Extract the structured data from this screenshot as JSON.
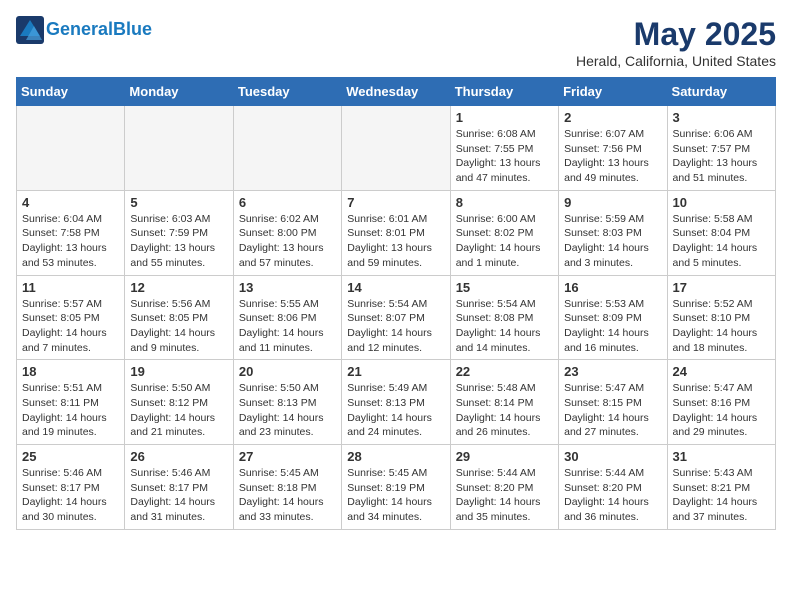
{
  "header": {
    "logo_line1": "General",
    "logo_line2": "Blue",
    "month_title": "May 2025",
    "location": "Herald, California, United States"
  },
  "days_of_week": [
    "Sunday",
    "Monday",
    "Tuesday",
    "Wednesday",
    "Thursday",
    "Friday",
    "Saturday"
  ],
  "weeks": [
    [
      {
        "day": "",
        "empty": true
      },
      {
        "day": "",
        "empty": true
      },
      {
        "day": "",
        "empty": true
      },
      {
        "day": "",
        "empty": true
      },
      {
        "day": "1",
        "sunrise": "Sunrise: 6:08 AM",
        "sunset": "Sunset: 7:55 PM",
        "daylight": "Daylight: 13 hours and 47 minutes."
      },
      {
        "day": "2",
        "sunrise": "Sunrise: 6:07 AM",
        "sunset": "Sunset: 7:56 PM",
        "daylight": "Daylight: 13 hours and 49 minutes."
      },
      {
        "day": "3",
        "sunrise": "Sunrise: 6:06 AM",
        "sunset": "Sunset: 7:57 PM",
        "daylight": "Daylight: 13 hours and 51 minutes."
      }
    ],
    [
      {
        "day": "4",
        "sunrise": "Sunrise: 6:04 AM",
        "sunset": "Sunset: 7:58 PM",
        "daylight": "Daylight: 13 hours and 53 minutes."
      },
      {
        "day": "5",
        "sunrise": "Sunrise: 6:03 AM",
        "sunset": "Sunset: 7:59 PM",
        "daylight": "Daylight: 13 hours and 55 minutes."
      },
      {
        "day": "6",
        "sunrise": "Sunrise: 6:02 AM",
        "sunset": "Sunset: 8:00 PM",
        "daylight": "Daylight: 13 hours and 57 minutes."
      },
      {
        "day": "7",
        "sunrise": "Sunrise: 6:01 AM",
        "sunset": "Sunset: 8:01 PM",
        "daylight": "Daylight: 13 hours and 59 minutes."
      },
      {
        "day": "8",
        "sunrise": "Sunrise: 6:00 AM",
        "sunset": "Sunset: 8:02 PM",
        "daylight": "Daylight: 14 hours and 1 minute."
      },
      {
        "day": "9",
        "sunrise": "Sunrise: 5:59 AM",
        "sunset": "Sunset: 8:03 PM",
        "daylight": "Daylight: 14 hours and 3 minutes."
      },
      {
        "day": "10",
        "sunrise": "Sunrise: 5:58 AM",
        "sunset": "Sunset: 8:04 PM",
        "daylight": "Daylight: 14 hours and 5 minutes."
      }
    ],
    [
      {
        "day": "11",
        "sunrise": "Sunrise: 5:57 AM",
        "sunset": "Sunset: 8:05 PM",
        "daylight": "Daylight: 14 hours and 7 minutes."
      },
      {
        "day": "12",
        "sunrise": "Sunrise: 5:56 AM",
        "sunset": "Sunset: 8:05 PM",
        "daylight": "Daylight: 14 hours and 9 minutes."
      },
      {
        "day": "13",
        "sunrise": "Sunrise: 5:55 AM",
        "sunset": "Sunset: 8:06 PM",
        "daylight": "Daylight: 14 hours and 11 minutes."
      },
      {
        "day": "14",
        "sunrise": "Sunrise: 5:54 AM",
        "sunset": "Sunset: 8:07 PM",
        "daylight": "Daylight: 14 hours and 12 minutes."
      },
      {
        "day": "15",
        "sunrise": "Sunrise: 5:54 AM",
        "sunset": "Sunset: 8:08 PM",
        "daylight": "Daylight: 14 hours and 14 minutes."
      },
      {
        "day": "16",
        "sunrise": "Sunrise: 5:53 AM",
        "sunset": "Sunset: 8:09 PM",
        "daylight": "Daylight: 14 hours and 16 minutes."
      },
      {
        "day": "17",
        "sunrise": "Sunrise: 5:52 AM",
        "sunset": "Sunset: 8:10 PM",
        "daylight": "Daylight: 14 hours and 18 minutes."
      }
    ],
    [
      {
        "day": "18",
        "sunrise": "Sunrise: 5:51 AM",
        "sunset": "Sunset: 8:11 PM",
        "daylight": "Daylight: 14 hours and 19 minutes."
      },
      {
        "day": "19",
        "sunrise": "Sunrise: 5:50 AM",
        "sunset": "Sunset: 8:12 PM",
        "daylight": "Daylight: 14 hours and 21 minutes."
      },
      {
        "day": "20",
        "sunrise": "Sunrise: 5:50 AM",
        "sunset": "Sunset: 8:13 PM",
        "daylight": "Daylight: 14 hours and 23 minutes."
      },
      {
        "day": "21",
        "sunrise": "Sunrise: 5:49 AM",
        "sunset": "Sunset: 8:13 PM",
        "daylight": "Daylight: 14 hours and 24 minutes."
      },
      {
        "day": "22",
        "sunrise": "Sunrise: 5:48 AM",
        "sunset": "Sunset: 8:14 PM",
        "daylight": "Daylight: 14 hours and 26 minutes."
      },
      {
        "day": "23",
        "sunrise": "Sunrise: 5:47 AM",
        "sunset": "Sunset: 8:15 PM",
        "daylight": "Daylight: 14 hours and 27 minutes."
      },
      {
        "day": "24",
        "sunrise": "Sunrise: 5:47 AM",
        "sunset": "Sunset: 8:16 PM",
        "daylight": "Daylight: 14 hours and 29 minutes."
      }
    ],
    [
      {
        "day": "25",
        "sunrise": "Sunrise: 5:46 AM",
        "sunset": "Sunset: 8:17 PM",
        "daylight": "Daylight: 14 hours and 30 minutes."
      },
      {
        "day": "26",
        "sunrise": "Sunrise: 5:46 AM",
        "sunset": "Sunset: 8:17 PM",
        "daylight": "Daylight: 14 hours and 31 minutes."
      },
      {
        "day": "27",
        "sunrise": "Sunrise: 5:45 AM",
        "sunset": "Sunset: 8:18 PM",
        "daylight": "Daylight: 14 hours and 33 minutes."
      },
      {
        "day": "28",
        "sunrise": "Sunrise: 5:45 AM",
        "sunset": "Sunset: 8:19 PM",
        "daylight": "Daylight: 14 hours and 34 minutes."
      },
      {
        "day": "29",
        "sunrise": "Sunrise: 5:44 AM",
        "sunset": "Sunset: 8:20 PM",
        "daylight": "Daylight: 14 hours and 35 minutes."
      },
      {
        "day": "30",
        "sunrise": "Sunrise: 5:44 AM",
        "sunset": "Sunset: 8:20 PM",
        "daylight": "Daylight: 14 hours and 36 minutes."
      },
      {
        "day": "31",
        "sunrise": "Sunrise: 5:43 AM",
        "sunset": "Sunset: 8:21 PM",
        "daylight": "Daylight: 14 hours and 37 minutes."
      }
    ]
  ]
}
